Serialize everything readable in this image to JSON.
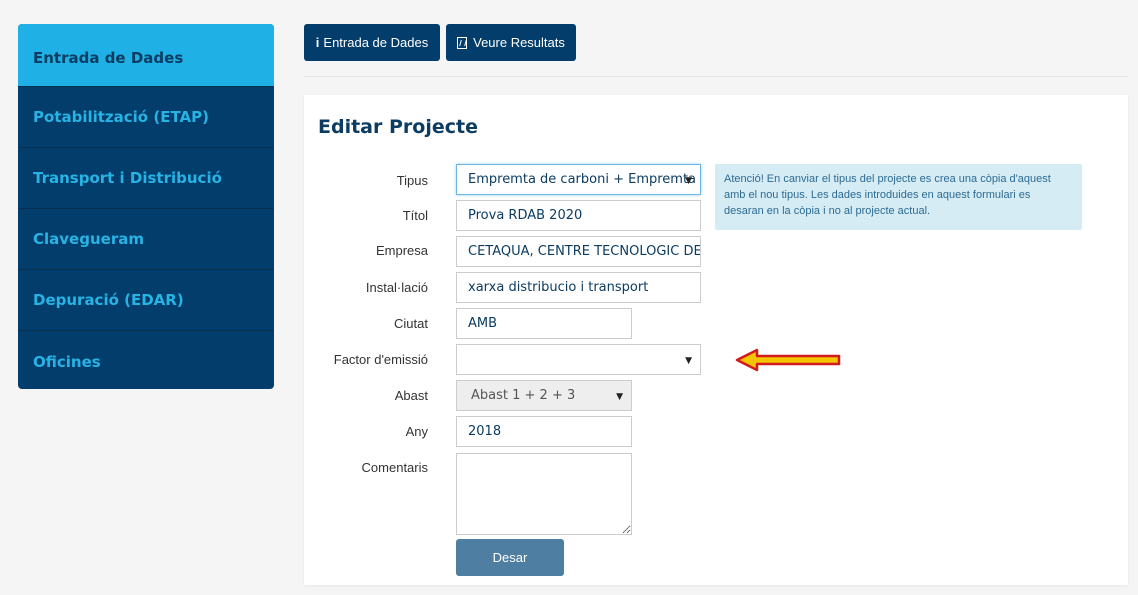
{
  "sidebar": {
    "items": [
      {
        "label": "Entrada de Dades"
      },
      {
        "label": "Potabilització (ETAP)"
      },
      {
        "label": "Transport i Distribució"
      },
      {
        "label": "Clavegueram"
      },
      {
        "label": "Depuració (EDAR)"
      },
      {
        "label": "Oficines"
      }
    ],
    "active_index": 0
  },
  "toolbar": {
    "entrada_icon": "i",
    "entrada_label": "Entrada de Dades",
    "resultats_icon": "document-icon",
    "resultats_label": "Veure Resultats"
  },
  "form": {
    "title": "Editar Projecte",
    "fields": {
      "tipus": {
        "label": "Tipus",
        "value": "Empremta de carboni + Empremta"
      },
      "titol": {
        "label": "Títol",
        "value": "Prova RDAB 2020"
      },
      "empresa": {
        "label": "Empresa",
        "value": "CETAQUA, CENTRE TECNOLOGIC DE L'"
      },
      "installacio": {
        "label": "Instal·lació",
        "value": "xarxa distribucio i transport"
      },
      "ciutat": {
        "label": "Ciutat",
        "value": "AMB"
      },
      "factor": {
        "label": "Factor d'emissió",
        "value": ""
      },
      "abast": {
        "label": "Abast",
        "value": "Abast 1 + 2 + 3"
      },
      "any": {
        "label": "Any",
        "value": "2018"
      },
      "comentaris": {
        "label": "Comentaris",
        "value": ""
      }
    },
    "save_label": "Desar",
    "alert_text": "Atenció! En canviar el tipus del projecte es crea una còpia d'aquest amb el nou tipus. Les dades introduides en aquest formulari es desaran en la còpia i no al projecte actual."
  },
  "colors": {
    "sidebar_bg": "#023d6b",
    "sidebar_active": "#1fb1e6",
    "sidebar_text": "#27b4e5",
    "accent_dark": "#0c3c61",
    "save_button": "#4f7ea3",
    "alert_bg": "#d5ecf5",
    "arrow_fill": "#f4c400",
    "arrow_stroke": "#d01c1c"
  }
}
